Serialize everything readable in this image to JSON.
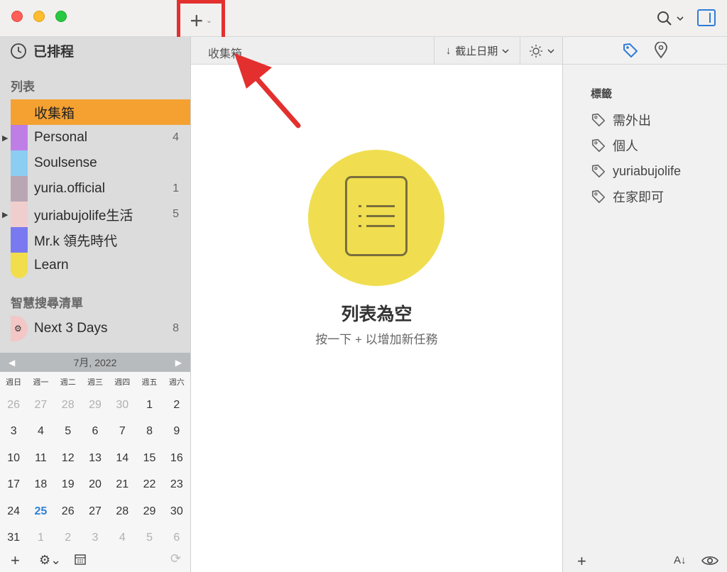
{
  "window": {
    "add_button": "+",
    "add_chevron": "⌄"
  },
  "sidebar": {
    "scheduled": "已排程",
    "lists_heading": "列表",
    "lists": [
      {
        "label": "收集箱",
        "count": "",
        "color": "#f4a132",
        "active": true
      },
      {
        "label": "Personal",
        "count": "4",
        "color": "#bf7ee6",
        "expandable": true
      },
      {
        "label": "Soulsense",
        "count": "",
        "color": "#8ccdf2"
      },
      {
        "label": "yuria.official",
        "count": "1",
        "color": "#b9a6b3"
      },
      {
        "label": "yuriabujolife生活",
        "count": "5",
        "color": "#f1cece",
        "expandable": true
      },
      {
        "label": "Mr.k 領先時代",
        "count": "",
        "color": "#7a7af0"
      },
      {
        "label": "Learn",
        "count": "",
        "color": "#f2dd4c"
      }
    ],
    "smart_heading": "智慧搜尋清單",
    "smart_lists": [
      {
        "label": "Next 3 Days",
        "count": "8",
        "color": "#f2c7c6"
      }
    ]
  },
  "calendar": {
    "month": "7月, 2022",
    "prev": "◀",
    "next": "▶",
    "weekdays": [
      "週日",
      "週一",
      "週二",
      "週三",
      "週四",
      "週五",
      "週六"
    ],
    "weeks": [
      [
        "26",
        "27",
        "28",
        "29",
        "30",
        "1",
        "2"
      ],
      [
        "3",
        "4",
        "5",
        "6",
        "7",
        "8",
        "9"
      ],
      [
        "10",
        "11",
        "12",
        "13",
        "14",
        "15",
        "16"
      ],
      [
        "17",
        "18",
        "19",
        "20",
        "21",
        "22",
        "23"
      ],
      [
        "24",
        "25",
        "26",
        "27",
        "28",
        "29",
        "30"
      ],
      [
        "31",
        "1",
        "2",
        "3",
        "4",
        "5",
        "6"
      ]
    ],
    "today": "25"
  },
  "main": {
    "title": "收集箱",
    "sort_label": "截止日期",
    "empty_title": "列表為空",
    "empty_subtitle": "按一下 + 以增加新任務"
  },
  "right": {
    "tags_heading": "標籤",
    "tags": [
      "需外出",
      "個人",
      "yuriabujolife",
      "在家即可"
    ]
  }
}
